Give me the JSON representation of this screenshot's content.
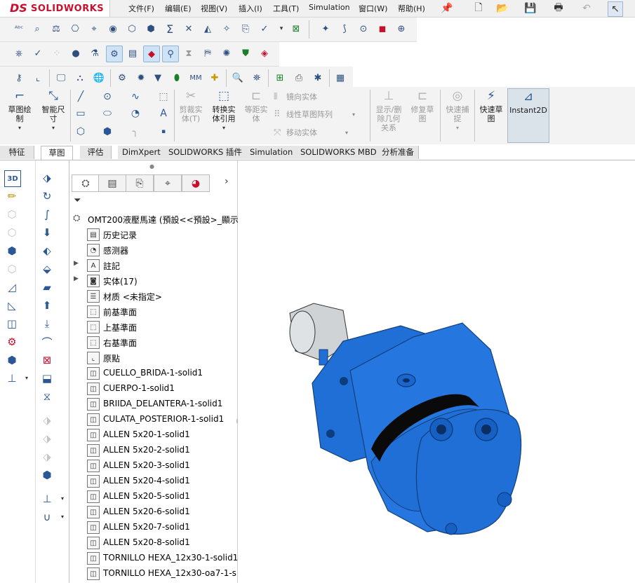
{
  "app": {
    "logo_ds": "DS",
    "logo_name": "SOLIDWORKS"
  },
  "menu": [
    "文件(F)",
    "编辑(E)",
    "视图(V)",
    "插入(I)",
    "工具(T)",
    "Simulation",
    "窗口(W)",
    "帮助(H)"
  ],
  "command_manager": {
    "sketch": "草图绘\n制",
    "smart_dim": "智能尺\n寸",
    "trim": "剪裁实\n体(T)",
    "convert": "转换实\n体引用",
    "offset": "等距实\n体",
    "mirror": "镜向实体",
    "linear_pattern": "线性草图阵列",
    "move": "移动实体",
    "display_delete": "显示/删\n除几何\n关系",
    "repair": "修复草\n图",
    "quick_snap": "快速捕\n捉",
    "rapid_sketch": "快速草\n图",
    "instant2d": "Instant2D"
  },
  "tabs": [
    "特征",
    "草图",
    "评估",
    "DimXpert",
    "SOLIDWORKS 插件",
    "Simulation",
    "SOLIDWORKS MBD",
    "分析准备"
  ],
  "feature_tree": {
    "root": "OMT200液壓馬達  (預設<<預設>_顯示",
    "items": [
      {
        "label": "历史记录",
        "icon": "history-icon",
        "arrow": false
      },
      {
        "label": "感测器",
        "icon": "sensor-icon",
        "arrow": false
      },
      {
        "label": "註記",
        "icon": "annotation-icon",
        "arrow": true
      },
      {
        "label": "实体(17)",
        "icon": "solid-bodies-icon",
        "arrow": true
      },
      {
        "label": "材质 <未指定>",
        "icon": "material-icon",
        "arrow": false
      },
      {
        "label": "前基準面",
        "icon": "plane-icon",
        "arrow": false
      },
      {
        "label": "上基準面",
        "icon": "plane-icon",
        "arrow": false
      },
      {
        "label": "右基準面",
        "icon": "plane-icon",
        "arrow": false
      },
      {
        "label": "原點",
        "icon": "origin-icon",
        "arrow": false
      },
      {
        "label": "CUELLO_BRIDA-1-solid1",
        "icon": "body-icon",
        "arrow": false
      },
      {
        "label": "CUERPO-1-solid1",
        "icon": "body-icon",
        "arrow": false
      },
      {
        "label": "BRIIDA_DELANTERA-1-solid1",
        "icon": "body-icon",
        "arrow": false
      },
      {
        "label": "CULATA_POSTERIOR-1-solid1",
        "icon": "body-icon",
        "arrow": false
      },
      {
        "label": "ALLEN 5x20-1-solid1",
        "icon": "body-icon",
        "arrow": false
      },
      {
        "label": "ALLEN 5x20-2-solid1",
        "icon": "body-icon",
        "arrow": false
      },
      {
        "label": "ALLEN 5x20-3-solid1",
        "icon": "body-icon",
        "arrow": false
      },
      {
        "label": "ALLEN 5x20-4-solid1",
        "icon": "body-icon",
        "arrow": false
      },
      {
        "label": "ALLEN 5x20-5-solid1",
        "icon": "body-icon",
        "arrow": false
      },
      {
        "label": "ALLEN 5x20-6-solid1",
        "icon": "body-icon",
        "arrow": false
      },
      {
        "label": "ALLEN 5x20-7-solid1",
        "icon": "body-icon",
        "arrow": false
      },
      {
        "label": "ALLEN 5x20-8-solid1",
        "icon": "body-icon",
        "arrow": false
      },
      {
        "label": "TORNILLO HEXA_12x30-1-solid1",
        "icon": "body-icon",
        "arrow": false
      },
      {
        "label": "TORNILLO HEXA_12x30-oa7-1-s",
        "icon": "body-icon",
        "arrow": false
      }
    ]
  },
  "colors": {
    "brand": "#c8102e",
    "model_blue": "#1f6fd6",
    "model_dark": "#123f7a",
    "shaft": "#cfd3d6"
  }
}
